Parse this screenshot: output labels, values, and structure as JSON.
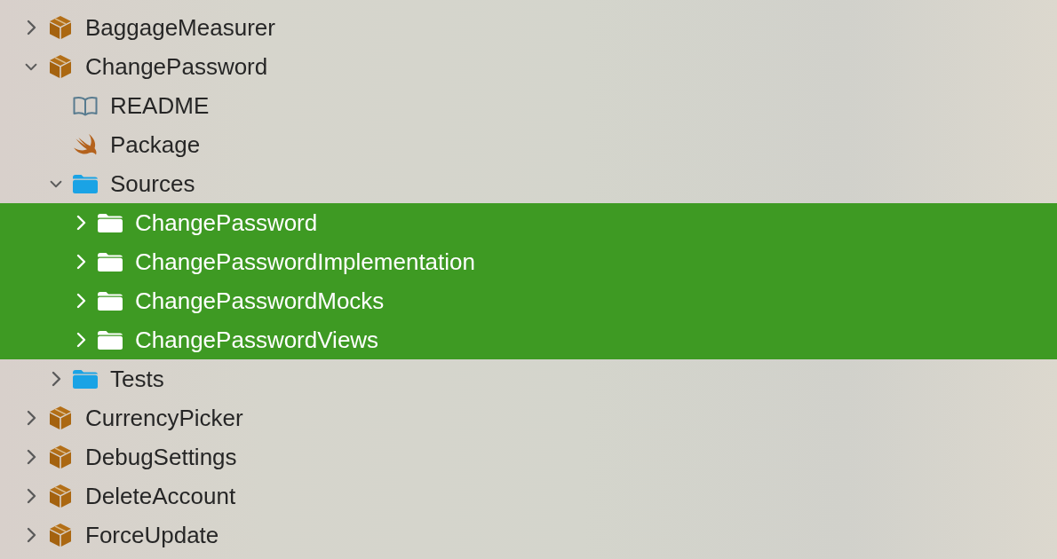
{
  "tree": [
    {
      "kind": "package",
      "label": "BaggageMeasurer",
      "expanded": false,
      "selected": false
    },
    {
      "kind": "package",
      "label": "ChangePassword",
      "expanded": true,
      "selected": false,
      "children": [
        {
          "kind": "readme",
          "label": "README",
          "selected": false
        },
        {
          "kind": "swift",
          "label": "Package",
          "selected": false
        },
        {
          "kind": "folder",
          "label": "Sources",
          "expanded": true,
          "selected": false,
          "children": [
            {
              "kind": "folder",
              "label": "ChangePassword",
              "expanded": false,
              "selected": true
            },
            {
              "kind": "folder",
              "label": "ChangePasswordImplementation",
              "expanded": false,
              "selected": true
            },
            {
              "kind": "folder",
              "label": "ChangePasswordMocks",
              "expanded": false,
              "selected": true
            },
            {
              "kind": "folder",
              "label": "ChangePasswordViews",
              "expanded": false,
              "selected": true
            }
          ]
        },
        {
          "kind": "folder",
          "label": "Tests",
          "expanded": false,
          "selected": false
        }
      ]
    },
    {
      "kind": "package",
      "label": "CurrencyPicker",
      "expanded": false,
      "selected": false
    },
    {
      "kind": "package",
      "label": "DebugSettings",
      "expanded": false,
      "selected": false
    },
    {
      "kind": "package",
      "label": "DeleteAccount",
      "expanded": false,
      "selected": false
    },
    {
      "kind": "package",
      "label": "ForceUpdate",
      "expanded": false,
      "selected": false
    }
  ]
}
